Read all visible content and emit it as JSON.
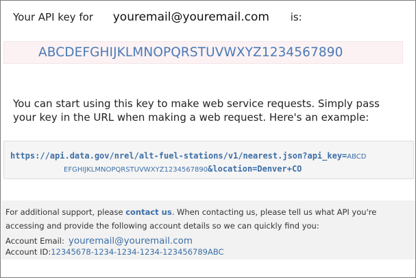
{
  "intro": {
    "prefix": "Your API key for",
    "email": "youremail@youremail.com",
    "suffix": "is:"
  },
  "api_key": "ABCDEFGHIJKLMNOPQRSTUVWXYZ1234567890",
  "usage_text": "You can start using this key to make web service requests. Simply pass your key in the URL when making a web request. Here's an example:",
  "example": {
    "url_start": "https://api.data.gov/nrel/alt-fuel-stations/v1/nearest.json?api_key=",
    "key_part1": "ABCD",
    "key_part2": "EFGHIJKLMNOPQRSTUVWXYZ1234567890",
    "url_end": "&location=Denver+CO"
  },
  "support": {
    "text_before": "For additional support, please ",
    "link_label": "contact us",
    "text_after": ". When contacting us, please tell us what API you're accessing and provide the following account details so we can quickly find you:",
    "email_label": "Account Email:",
    "email_value": "youremail@youremail.com",
    "id_label": "Account ID:",
    "id_value": "12345678-1234-1234-1234-123456789ABC"
  },
  "colors": {
    "link": "#3c6ea6",
    "key_bar_bg": "#fcf2f4",
    "example_bg": "#f5f5f5",
    "support_bg": "#f2f2f2"
  }
}
